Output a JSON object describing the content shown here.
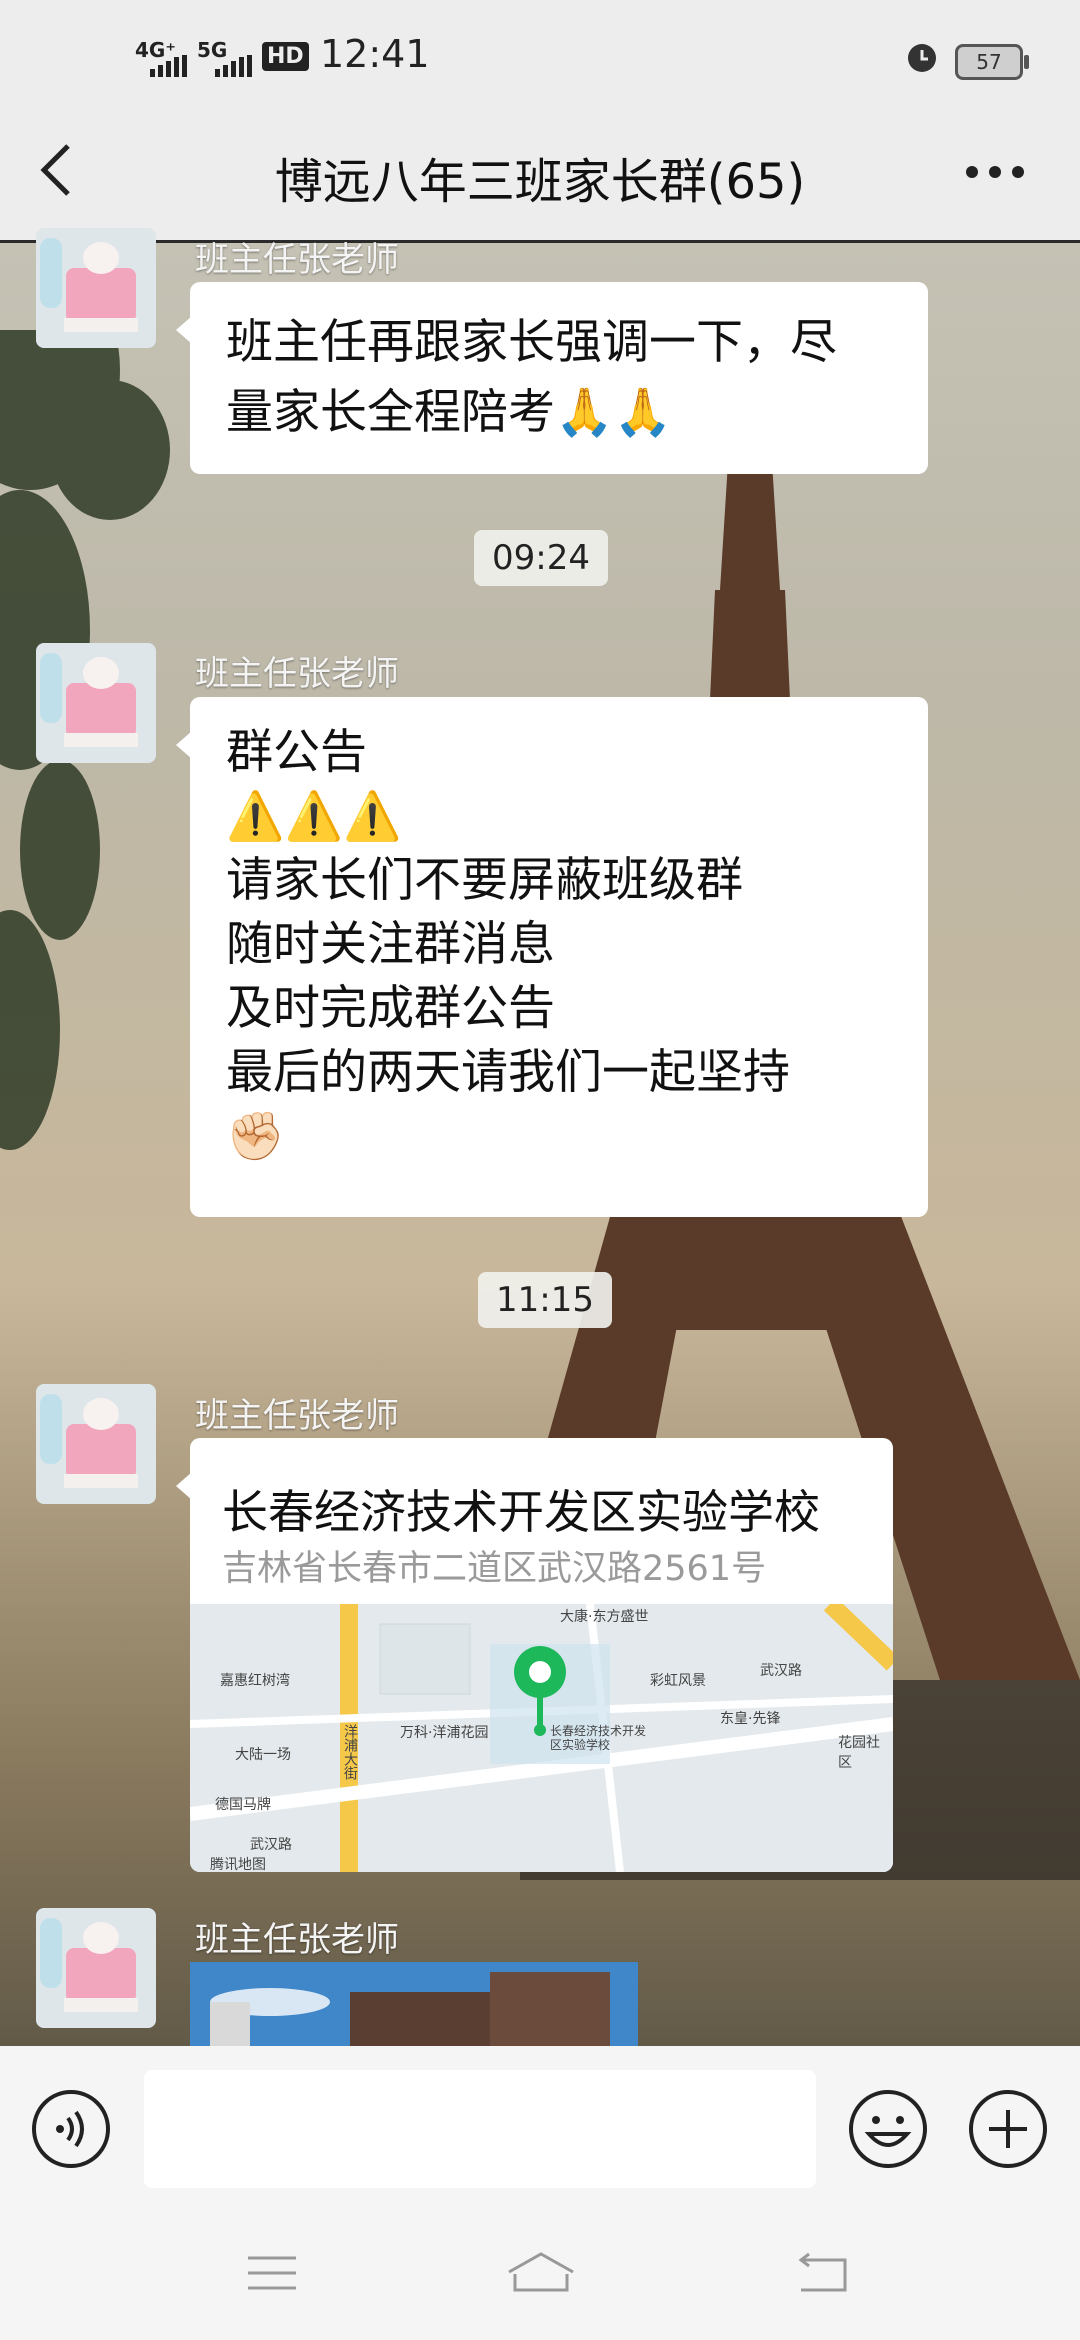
{
  "status_bar": {
    "signal_1": "4G⁺",
    "signal_2": "5G",
    "hd": "HD",
    "time": "12:41",
    "battery": "57"
  },
  "header": {
    "title": "博远八年三班家长群(65)"
  },
  "messages": [
    {
      "sender": "班主任张老师",
      "text_lines": [
        "班主任再跟家长强调一下，尽",
        "量家长全程陪考🙏🙏"
      ]
    },
    {
      "timestamp": "09:24"
    },
    {
      "sender": "班主任张老师",
      "text_lines": [
        "群公告",
        "⚠️⚠️⚠️",
        "请家长们不要屏蔽班级群",
        "随时关注群消息",
        "及时完成群公告",
        "最后的两天请我们一起坚持",
        "✊🏻"
      ]
    },
    {
      "timestamp": "11:15"
    },
    {
      "sender": "班主任张老师",
      "location": {
        "name": "长春经济技术开发区实验学校",
        "address": "吉林省长春市二道区武汉路2561号",
        "map_labels": {
          "top": "大康·东方盛世",
          "poi1": "嘉惠红树湾",
          "poi2": "大陆一场",
          "poi3": "德国马牌",
          "road1": "洋浦大街",
          "poi4": "万科·洋浦花园",
          "school": "长春经济技术开发区实验学校",
          "poi5": "彩虹风景",
          "road2": "武汉路",
          "poi6": "东皇·先锋",
          "poi7": "花园社区",
          "road3": "武汉路",
          "provider": "腾讯地图"
        }
      }
    },
    {
      "sender": "班主任张老师",
      "image": true
    }
  ],
  "input": {
    "placeholder": ""
  }
}
